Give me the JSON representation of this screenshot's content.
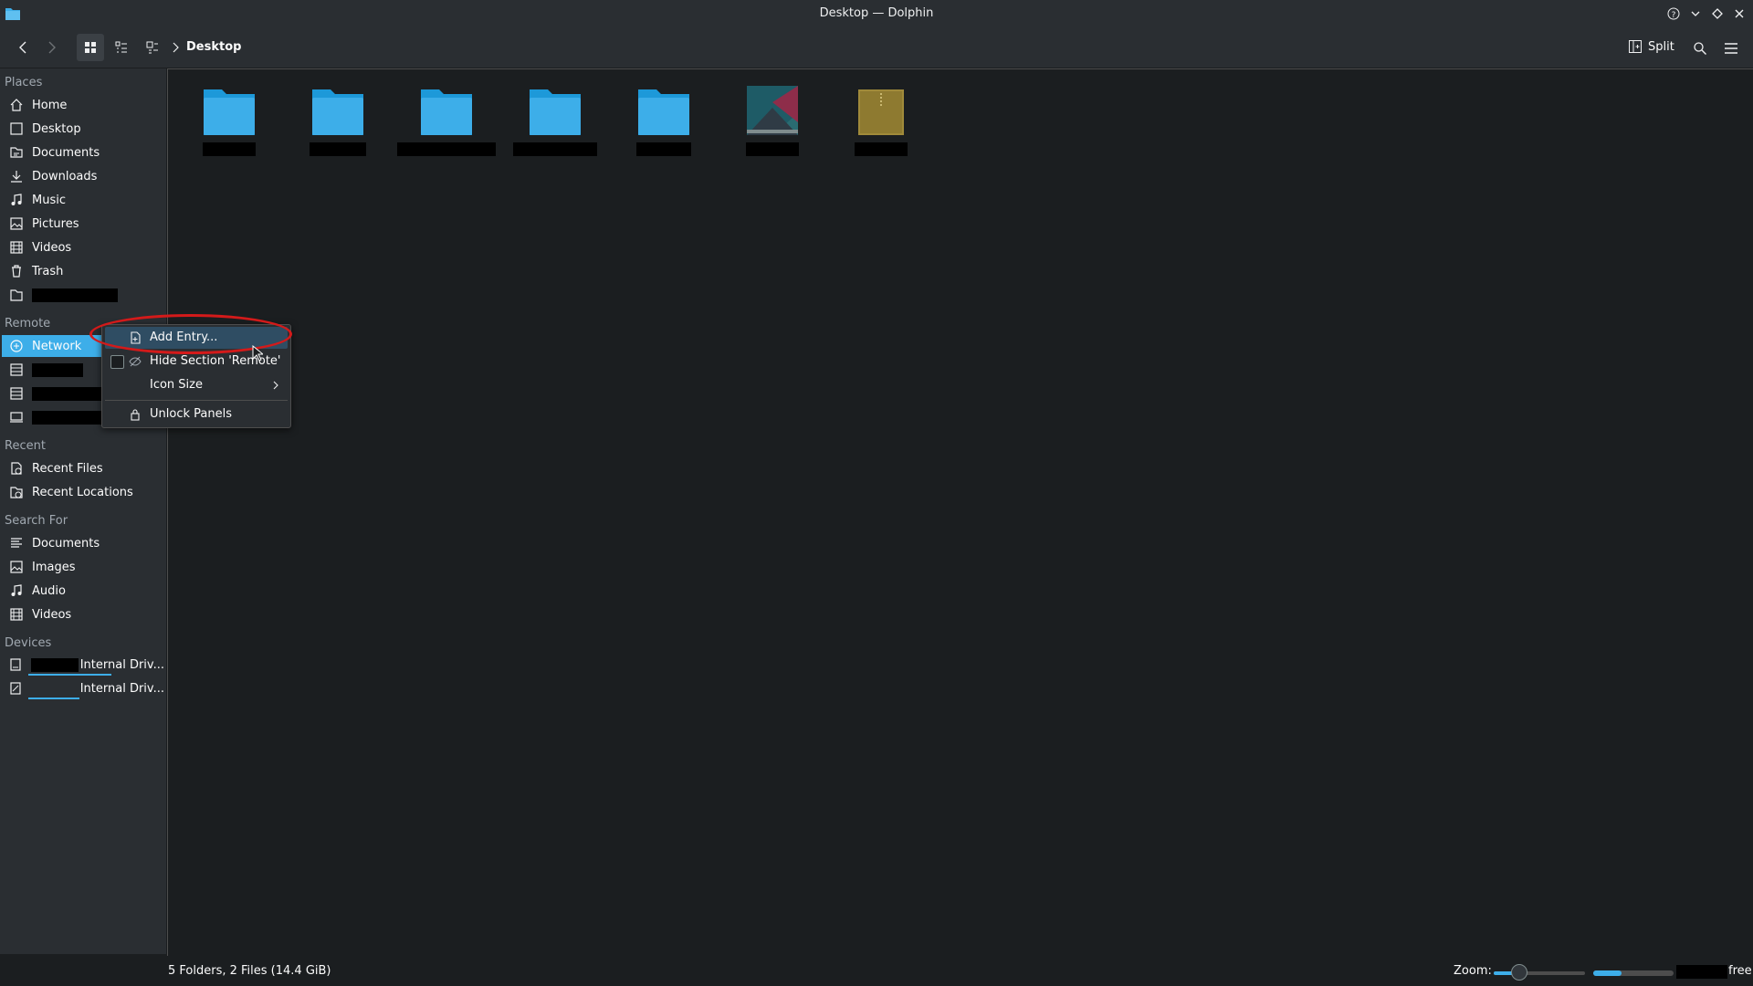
{
  "window": {
    "title": "Desktop — Dolphin",
    "app_icon": "folder-app-icon",
    "controls": [
      "help-icon",
      "minimize-icon",
      "maximize-icon",
      "close-icon"
    ]
  },
  "toolbar": {
    "view_modes": [
      "icons-view-icon",
      "details-view-icon",
      "compact-view-icon"
    ],
    "active_view": "icons",
    "breadcrumb": "Desktop",
    "split_label": "Split"
  },
  "sidebar": {
    "places_header": "Places",
    "places": [
      {
        "label": "Home",
        "icon": "home-icon"
      },
      {
        "label": "Desktop",
        "icon": "desktop-icon"
      },
      {
        "label": "Documents",
        "icon": "documents-icon"
      },
      {
        "label": "Downloads",
        "icon": "downloads-icon"
      },
      {
        "label": "Music",
        "icon": "music-icon"
      },
      {
        "label": "Pictures",
        "icon": "pictures-icon"
      },
      {
        "label": "Videos",
        "icon": "videos-icon"
      },
      {
        "label": "Trash",
        "icon": "trash-icon"
      }
    ],
    "remote_header": "Remote",
    "network_label": "Network",
    "recent_header": "Recent",
    "recent": [
      {
        "label": "Recent Files",
        "icon": "recent-files-icon"
      },
      {
        "label": "Recent Locations",
        "icon": "recent-locations-icon"
      }
    ],
    "search_header": "Search For",
    "search": [
      {
        "label": "Documents",
        "icon": "text-search-icon"
      },
      {
        "label": "Images",
        "icon": "image-search-icon"
      },
      {
        "label": "Audio",
        "icon": "audio-search-icon"
      },
      {
        "label": "Videos",
        "icon": "video-search-icon"
      }
    ],
    "devices_header": "Devices",
    "devices": [
      {
        "label": "Internal Driv...",
        "icon": "drive-icon",
        "usage": 0.65
      },
      {
        "label": "Internal Driv...",
        "icon": "drive-icon",
        "usage": 0.4
      }
    ]
  },
  "files": [
    {
      "type": "folder",
      "icon": "folder-icon"
    },
    {
      "type": "folder",
      "icon": "folder-icon"
    },
    {
      "type": "folder",
      "icon": "folder-icon"
    },
    {
      "type": "folder",
      "icon": "folder-icon"
    },
    {
      "type": "folder",
      "icon": "folder-icon"
    },
    {
      "type": "image",
      "icon": "image-file-icon"
    },
    {
      "type": "archive",
      "icon": "archive-file-icon"
    }
  ],
  "context_menu": {
    "items": [
      {
        "label": "Add Entry...",
        "icon": "add-entry-icon",
        "highlighted": true
      },
      {
        "label": "Hide Section 'Remote'",
        "icon": "hide-icon",
        "checkbox": true
      },
      {
        "label": "Icon Size",
        "submenu": true
      },
      {
        "label": "Unlock Panels",
        "icon": "lock-icon"
      }
    ]
  },
  "statusbar": {
    "summary": "5 Folders, 2 Files (14.4 GiB)",
    "zoom_label": "Zoom:",
    "zoom_value": 0.25,
    "free_label": "free",
    "disk_usage": 0.35
  },
  "colors": {
    "accent": "#3daee9",
    "window_bg": "#1b1e20",
    "panel_bg": "#2a2e32",
    "annotation": "#d31a1a"
  }
}
